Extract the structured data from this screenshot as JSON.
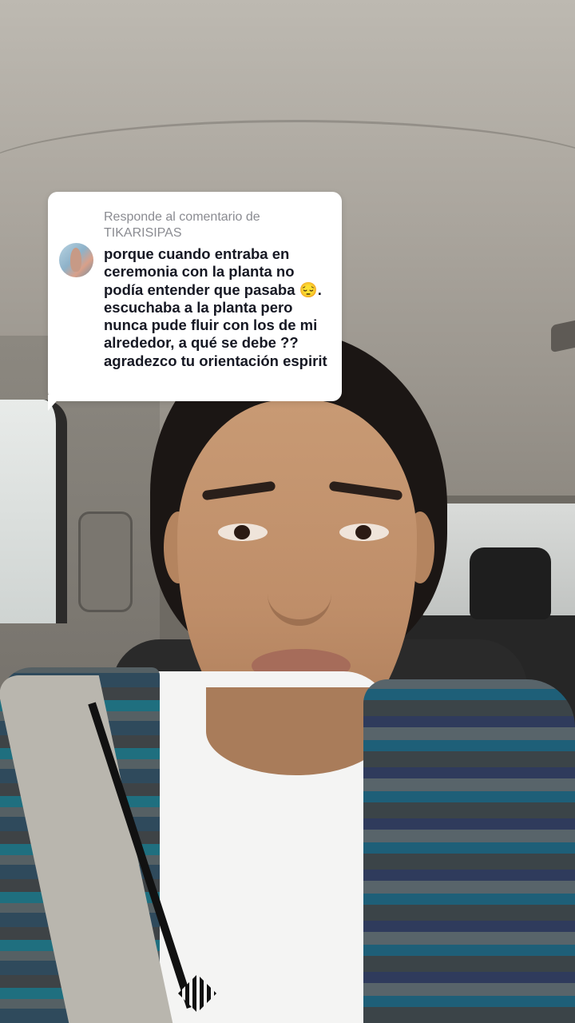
{
  "reply_card": {
    "header_line1": "Responde al comentario de",
    "header_line2": "TIKARISIPAS",
    "comment_text": "porque cuando entraba en ceremonia con la planta no podía entender que pasaba 😔. escuchaba a la planta pero nunca pude fluir con los de mi alrededor, a qué se debe ?? agradezco tu orientación espirit",
    "avatar_icon": "user-avatar-icon"
  },
  "colors": {
    "card_background": "#ffffff",
    "header_text": "#8a8b91",
    "body_text": "#161823"
  }
}
